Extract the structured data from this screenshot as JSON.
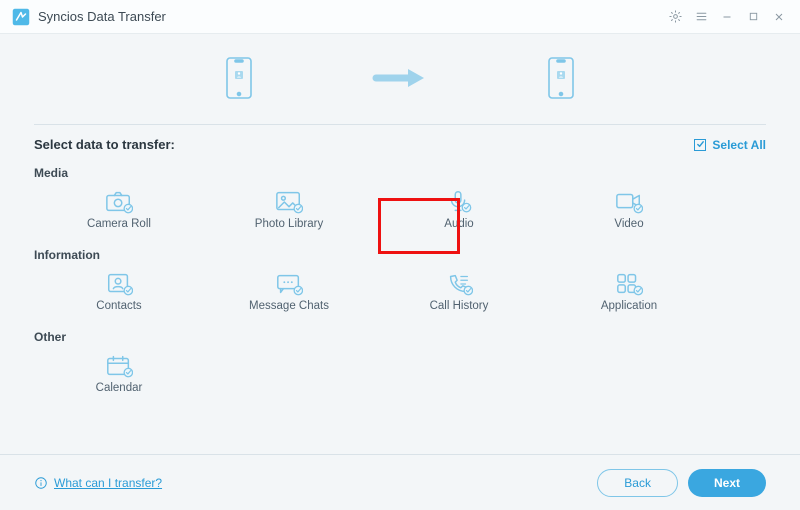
{
  "app_title": "Syncios Data Transfer",
  "select_label": "Select data to transfer:",
  "select_all_label": "Select All",
  "categories": {
    "media": {
      "label": "Media",
      "items": {
        "camera_roll": "Camera Roll",
        "photo_library": "Photo Library",
        "audio": "Audio",
        "video": "Video"
      }
    },
    "information": {
      "label": "Information",
      "items": {
        "contacts": "Contacts",
        "message_chats": "Message Chats",
        "call_history": "Call History",
        "application": "Application"
      }
    },
    "other": {
      "label": "Other",
      "items": {
        "calendar": "Calendar"
      }
    }
  },
  "help_text": "What can I transfer?",
  "buttons": {
    "back": "Back",
    "next": "Next"
  },
  "highlighted_item": "audio"
}
